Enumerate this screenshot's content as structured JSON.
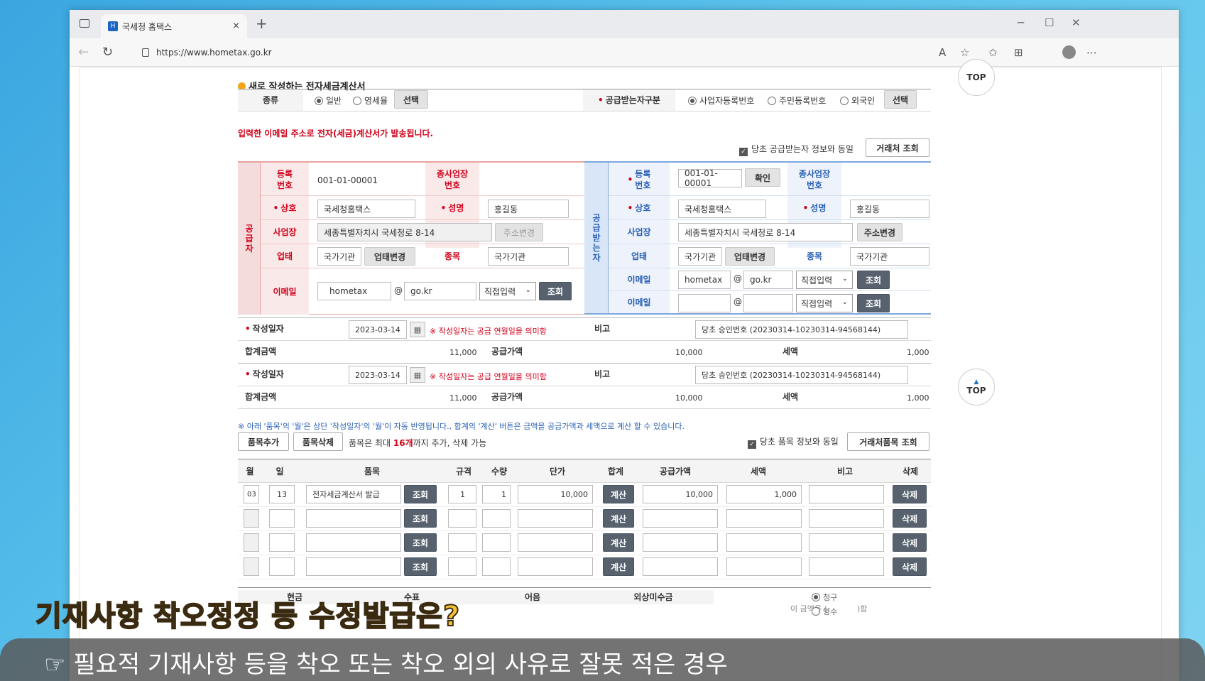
{
  "browser": {
    "tab_title": "국세청 홈택스",
    "url": "https://www.hometax.go.kr",
    "new_tab": "+",
    "close": "×"
  },
  "section_title": "새로 작성하는 전자세금계산서",
  "top_label": "TOP",
  "kind": {
    "label": "종류",
    "opt1": "일반",
    "opt2": "영세율",
    "select_btn": "선택"
  },
  "buyer_type": {
    "label": "공급받는자구분",
    "opt1": "사업자등록번호",
    "opt2": "주민등록번호",
    "opt3": "외국인",
    "select_btn": "선택"
  },
  "email_notice": "입력한 이메일 주소로 전자(세금)계산서가 발송됩니다.",
  "same_as_buyer": "당초 공급받는자 정보와 동일",
  "client_lookup": "거래처 조회",
  "supplier": {
    "side_label": "공\n급\n자",
    "reg_label": "등록\n번호",
    "reg_value": "001-01-00001",
    "branch_label": "종사업장\n번호",
    "name_label": "상호",
    "name_value": "국세청홈택스",
    "rep_label": "성명",
    "rep_value": "홍길동",
    "addr_label": "사업장",
    "addr_value": "세종특별자치시 국세청로 8-14",
    "addr_btn": "주소변경",
    "biz_label": "업태",
    "biz_value": "국가기관",
    "biz_btn": "업태변경",
    "item_label": "종목",
    "item_value": "국가기관",
    "email_label": "이메일",
    "email_id": "hometax",
    "at": "@",
    "email_domain": "go.kr",
    "email_sel": "직접입력",
    "lookup": "조회"
  },
  "buyer": {
    "side_label": "공\n급\n받\n는\n자",
    "reg_label": "등록\n번호",
    "reg_value": "001-01-00001",
    "confirm": "확인",
    "branch_label": "종사업장\n번호",
    "name_label": "상호",
    "name_value": "국세청홈택스",
    "rep_label": "성명",
    "rep_value": "홍길동",
    "addr_label": "사업장",
    "addr_value": "세종특별자치시 국세청로 8-14",
    "addr_btn": "주소변경",
    "biz_label": "업태",
    "biz_value": "국가기관",
    "biz_btn": "업태변경",
    "item_label": "종목",
    "item_value": "국가기관",
    "email_label": "이메일",
    "email_id": "hometax",
    "at": "@",
    "email_domain": "go.kr",
    "email_sel": "직접입력",
    "lookup": "조회",
    "email2_label": "이메일",
    "email2_sel": "직접입력",
    "lookup2": "조회"
  },
  "summary": [
    {
      "date_label": "작성일자",
      "date": "2023-03-14",
      "note": "※ 작성일자는 공급 연월일을 의미함",
      "remark_label": "비고",
      "remark": "당초 승인번호 (20230314-10230314-94568144)",
      "total_label": "합계금액",
      "total": "11,000",
      "supply_label": "공급가액",
      "supply": "10,000",
      "tax_label": "세액",
      "tax": "1,000"
    },
    {
      "date_label": "작성일자",
      "date": "2023-03-14",
      "note": "※ 작성일자는 공급 연월일을 의미함",
      "remark_label": "비고",
      "remark": "당초 승인번호 (20230314-10230314-94568144)",
      "total_label": "합계금액",
      "total": "11,000",
      "supply_label": "공급가액",
      "supply": "10,000",
      "tax_label": "세액",
      "tax": "1,000"
    }
  ],
  "items_notice": "※ 아래 '품목'의 '월'은 상단 '작성일자'의 '월'이 자동 반영됩니다., 합계의 '계산' 버튼은 금액을 공급가액과 세액으로 계산 할 수 있습니다.",
  "add_item": "품목추가",
  "del_item": "품목삭제",
  "item_limit_pre": "품목은 최대 ",
  "item_limit_num": "16개",
  "item_limit_post": "까지 추가, 삭제 가능",
  "same_item": "당초 품목 정보와 동일",
  "client_item_lookup": "거래처품목 조회",
  "table_headers": [
    "월",
    "일",
    "품목",
    "규격",
    "수량",
    "단가",
    "합계",
    "공급가액",
    "세액",
    "비고",
    "삭제"
  ],
  "rows": [
    {
      "month": "03",
      "day": "13",
      "item": "전자세금계산서 발급",
      "spec": "1",
      "qty": "1",
      "price": "10,000",
      "supply": "10,000",
      "tax": "1,000",
      "remark": ""
    },
    {
      "month": "",
      "day": "",
      "item": "",
      "spec": "",
      "qty": "",
      "price": "",
      "supply": "",
      "tax": "",
      "remark": ""
    },
    {
      "month": "",
      "day": "",
      "item": "",
      "spec": "",
      "qty": "",
      "price": "",
      "supply": "",
      "tax": "",
      "remark": ""
    },
    {
      "month": "",
      "day": "",
      "item": "",
      "spec": "",
      "qty": "",
      "price": "",
      "supply": "",
      "tax": "",
      "remark": ""
    }
  ],
  "row_lookup": "조회",
  "row_calc": "계산",
  "row_delete": "삭제",
  "payment_headers": [
    "현금",
    "수표",
    "어음",
    "외상미수금"
  ],
  "payment_amount": "이 금액을 (",
  "payment_claim": "청구",
  "payment_receipt": "영수",
  "payment_end": ")함",
  "overlay_title": "기재사항 착오정정 등 수정발급은?",
  "subtitle": "☞ 필요적 기재사항 등을 착오 또는 착오 외의 사유로 잘못 적은 경우",
  "colors": {
    "supplier": "#f5dcdc",
    "supplier_border": "#e6a3a3",
    "buyer": "#d9e6f7",
    "buyer_border": "#7fa7de",
    "accent": "#d0021b",
    "dark_btn": "#58626e"
  }
}
